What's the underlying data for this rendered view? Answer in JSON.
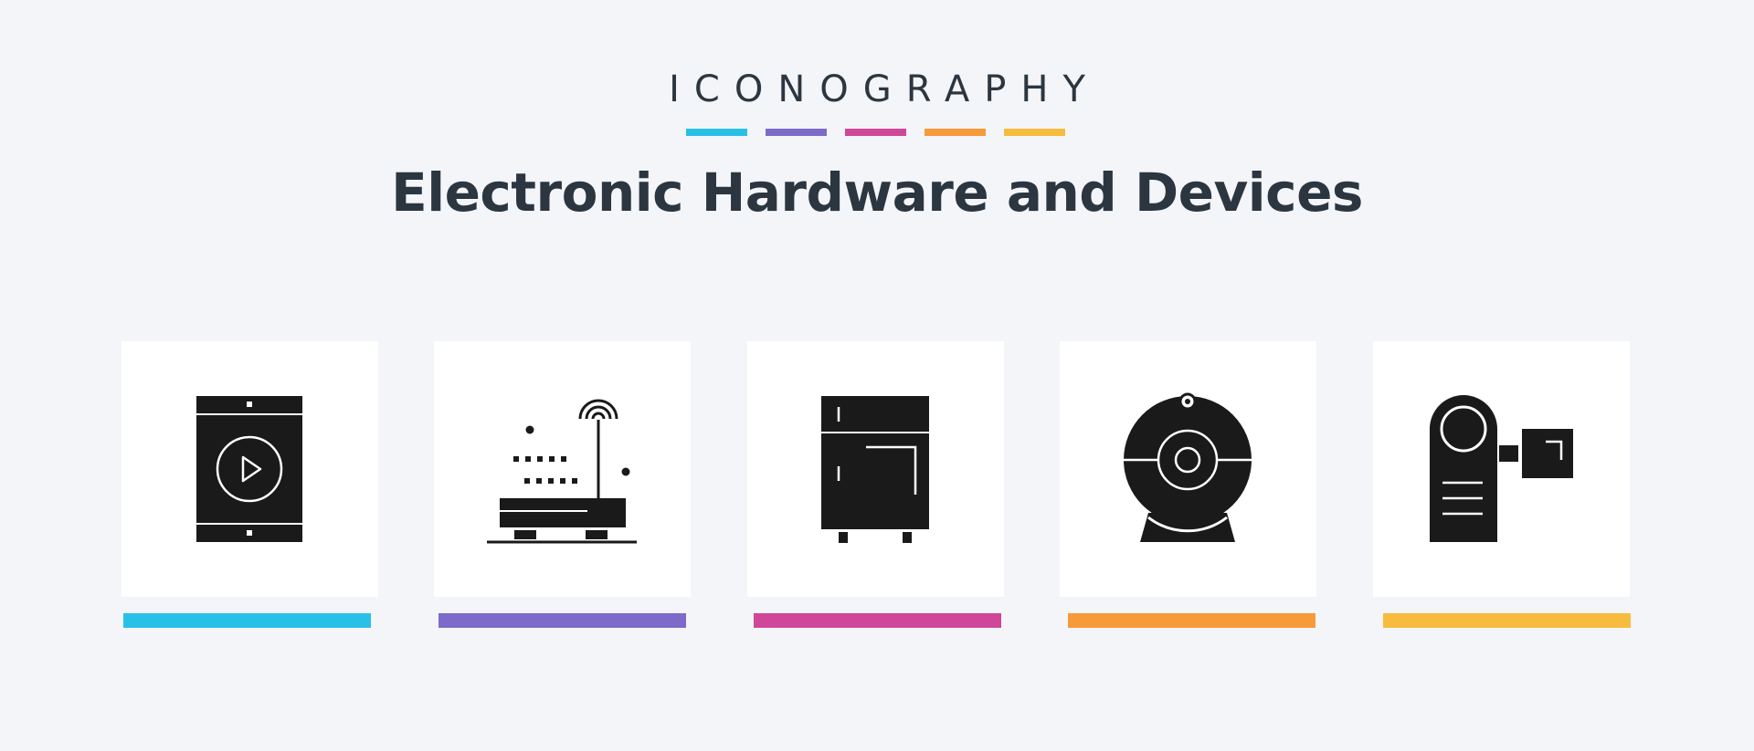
{
  "header": {
    "kicker": "ICONOGRAPHY",
    "title": "Electronic Hardware and Devices"
  },
  "colors": {
    "background": "#f4f5f9",
    "text": "#2b3640",
    "icon": "#1a1a1a",
    "accents": [
      "#29c0e8",
      "#7e6bc9",
      "#d0479a",
      "#f79a3a",
      "#f7bb3e"
    ]
  },
  "icons": [
    {
      "name": "smartphone-video-icon"
    },
    {
      "name": "wifi-router-icon"
    },
    {
      "name": "refrigerator-icon"
    },
    {
      "name": "webcam-icon"
    },
    {
      "name": "camcorder-icon"
    }
  ]
}
